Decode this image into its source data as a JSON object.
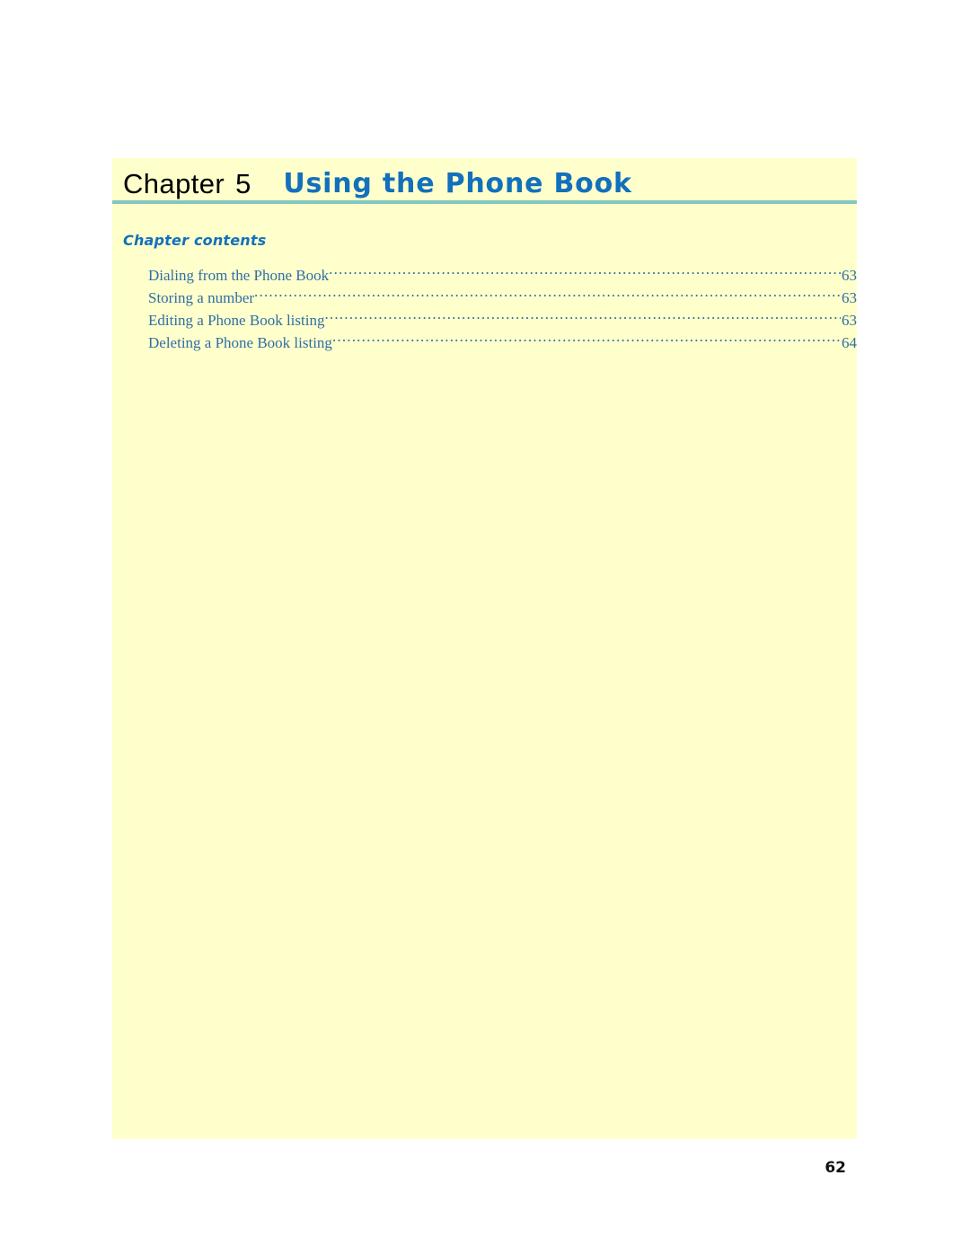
{
  "document": {
    "chapter": {
      "label": "Chapter",
      "number": "5",
      "title": "Using the Phone Book"
    },
    "contents": {
      "heading": "Chapter contents",
      "entries": [
        {
          "label": "Dialing from the Phone Book",
          "page": "63"
        },
        {
          "label": "Storing a number",
          "page": "63"
        },
        {
          "label": "Editing a Phone Book listing",
          "page": "63"
        },
        {
          "label": "Deleting a Phone Book listing",
          "page": "64"
        }
      ]
    },
    "footer": {
      "page_number": "62"
    },
    "colors": {
      "panel_background": "#ffffcc",
      "heading_blue": "#1270bd",
      "toc_blue": "#2f6ea5",
      "rule_teal": "#81c7be",
      "page_background": "#ffffff",
      "title_black": "#000000"
    }
  }
}
